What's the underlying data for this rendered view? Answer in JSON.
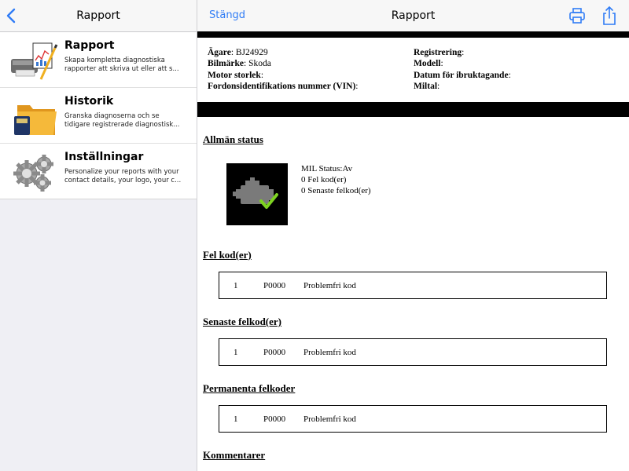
{
  "left_nav": {
    "title": "Rapport",
    "back_icon": "chevron-left-icon"
  },
  "menu": [
    {
      "title": "Rapport",
      "desc_line1": "Skapa kompletta diagnostiska",
      "desc_line2": "rapporter att skriva ut eller att s...",
      "icon": "printer-report-icon"
    },
    {
      "title": "Historik",
      "desc_line1": "Granska diagnoserna och se",
      "desc_line2": "tidigare registrerade diagnostisk...",
      "icon": "folder-icon"
    },
    {
      "title": "Inställningar",
      "desc_line1": "Personalize your reports with your",
      "desc_line2": "contact details, your logo, your c...",
      "icon": "gears-icon"
    }
  ],
  "right_nav": {
    "close_label": "Stängd",
    "title": "Rapport",
    "print_icon": "printer-icon",
    "share_icon": "share-icon"
  },
  "vehicle": {
    "owner_label": "Ägare",
    "owner_value": ": BJ24929",
    "brand_label": "Bilmärke",
    "brand_value": ": Skoda",
    "engine_label": "Motor storlek",
    "engine_value": ":",
    "vin_label": "Fordonsidentifikations nummer (VIN)",
    "vin_value": ":",
    "reg_label": "Registrering",
    "reg_value": ":",
    "model_label": "Modell",
    "model_value": ":",
    "date_label": "Datum för ibruktagande",
    "date_value": ":",
    "mileage_label": "Miltal",
    "mileage_value": ":"
  },
  "general_status": {
    "title": "Allmän status",
    "mil_status": "MIL Status:Av",
    "fault_count": "0 Fel kod(er)",
    "recent_count": "0 Senaste felkod(er)"
  },
  "fault_codes": {
    "title": "Fel kod(er)",
    "num": "1",
    "code": "P0000",
    "desc": "Problemfri kod"
  },
  "recent_codes": {
    "title": "Senaste felkod(er)",
    "num": "1",
    "code": "P0000",
    "desc": "Problemfri kod"
  },
  "permanent_codes": {
    "title": "Permanenta felkoder",
    "num": "1",
    "code": "P0000",
    "desc": "Problemfri kod"
  },
  "comments": {
    "title": "Kommentarer"
  },
  "colors": {
    "accent": "#2f7cf6",
    "nav_bg": "#f7f7f7",
    "sidebar_bg": "#efeff4",
    "check_green": "#7ed321"
  }
}
